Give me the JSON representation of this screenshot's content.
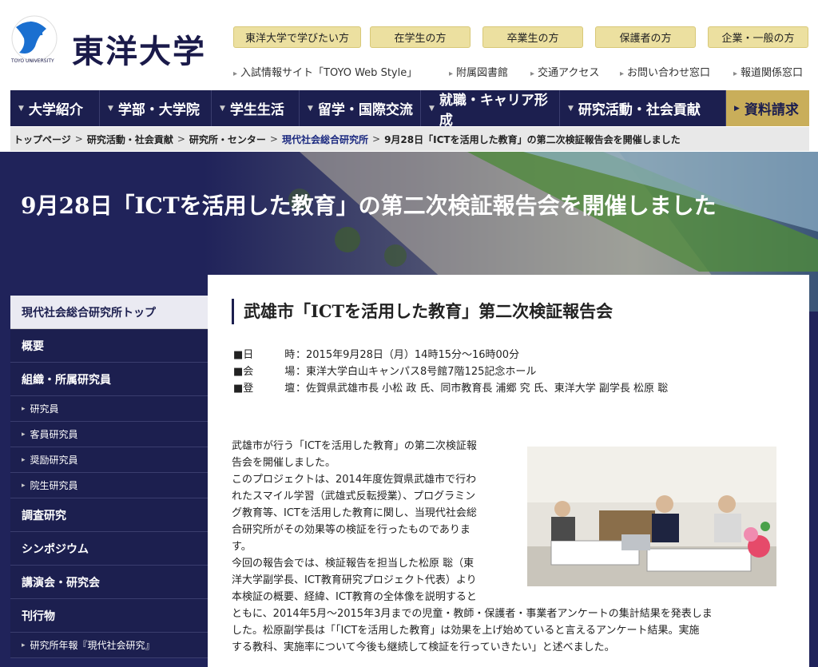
{
  "header": {
    "logo_text": "東洋大学",
    "logo_ring_text": "TOYO UNIVERSITY",
    "audience": [
      "東洋大学で学びたい方",
      "在学生の方",
      "卒業生の方",
      "保護者の方",
      "企業・一般の方"
    ],
    "sublinks": [
      "入試情報サイト「TOYO Web Style」",
      "附属図書館",
      "交通アクセス",
      "お問い合わせ窓口",
      "報道関係窓口"
    ]
  },
  "nav": {
    "items": [
      "大学紹介",
      "学部・大学院",
      "学生生活",
      "留学・国際交流",
      "就職・キャリア形成",
      "研究活動・社会貢献"
    ],
    "request": "資料請求"
  },
  "breadcrumb": {
    "items": [
      "トップページ",
      "研究活動・社会貢献",
      "研究所・センター",
      "現代社会総合研究所"
    ],
    "separator": ">",
    "current": "9月28日「ICTを活用した教育」の第二次検証報告会を開催しました"
  },
  "hero": {
    "title": "9月28日「ICTを活用した教育」の第二次検証報告会を開催しました"
  },
  "sidebar": {
    "top": "現代社会総合研究所トップ",
    "items": [
      {
        "label": "概要",
        "type": "main"
      },
      {
        "label": "組織・所属研究員",
        "type": "main"
      },
      {
        "label": "研究員",
        "type": "sub"
      },
      {
        "label": "客員研究員",
        "type": "sub"
      },
      {
        "label": "奨励研究員",
        "type": "sub"
      },
      {
        "label": "院生研究員",
        "type": "sub"
      },
      {
        "label": "調査研究",
        "type": "main"
      },
      {
        "label": "シンポジウム",
        "type": "main"
      },
      {
        "label": "講演会・研究会",
        "type": "main"
      },
      {
        "label": "刊行物",
        "type": "main"
      },
      {
        "label": "研究所年報『現代社会研究』",
        "type": "sub"
      }
    ]
  },
  "article": {
    "title": "武雄市「ICTを活用した教育」第二次検証報告会",
    "info": [
      {
        "key": "■日　　　時",
        "value": "：2015年9月28日（月）14時15分～16時00分"
      },
      {
        "key": "■会　　　場",
        "value": "：東洋大学白山キャンパス8号館7階125記念ホール"
      },
      {
        "key": "■登　　　壇",
        "value": "：佐賀県武雄市長 小松 政 氏、同市教育長 浦郷 究 氏、東洋大学 副学長 松原 聡"
      }
    ],
    "body_lines": [
      "武雄市が行う「ICTを活用した教育」の第二次検証報",
      "告会を開催しました。",
      "このプロジェクトは、2014年度佐賀県武雄市で行わ",
      "れたスマイル学習（武雄式反転授業）、プログラミン",
      "グ教育等、ICTを活用した教育に関し、当現代社会総",
      "合研究所がその効果等の検証を行ったものでありま",
      "す。",
      "今回の報告会では、検証報告を担当した松原 聡（東",
      "洋大学副学長、ICT教育研究プロジェクト代表）より",
      "本検証の概要、経緯、ICT教育の全体像を説明すると"
    ],
    "body_wide_lines": [
      "ともに、2014年5月～2015年3月までの児童・教師・保護者・事業者アンケートの集計結果を発表しま",
      "した。松原副学長は「「ICTを活用した教育」は効果を上げ始めていると言えるアンケート結果。実施",
      "する教科、実施率について今後も継続して検証を行っていきたい」と述べました。"
    ]
  }
}
